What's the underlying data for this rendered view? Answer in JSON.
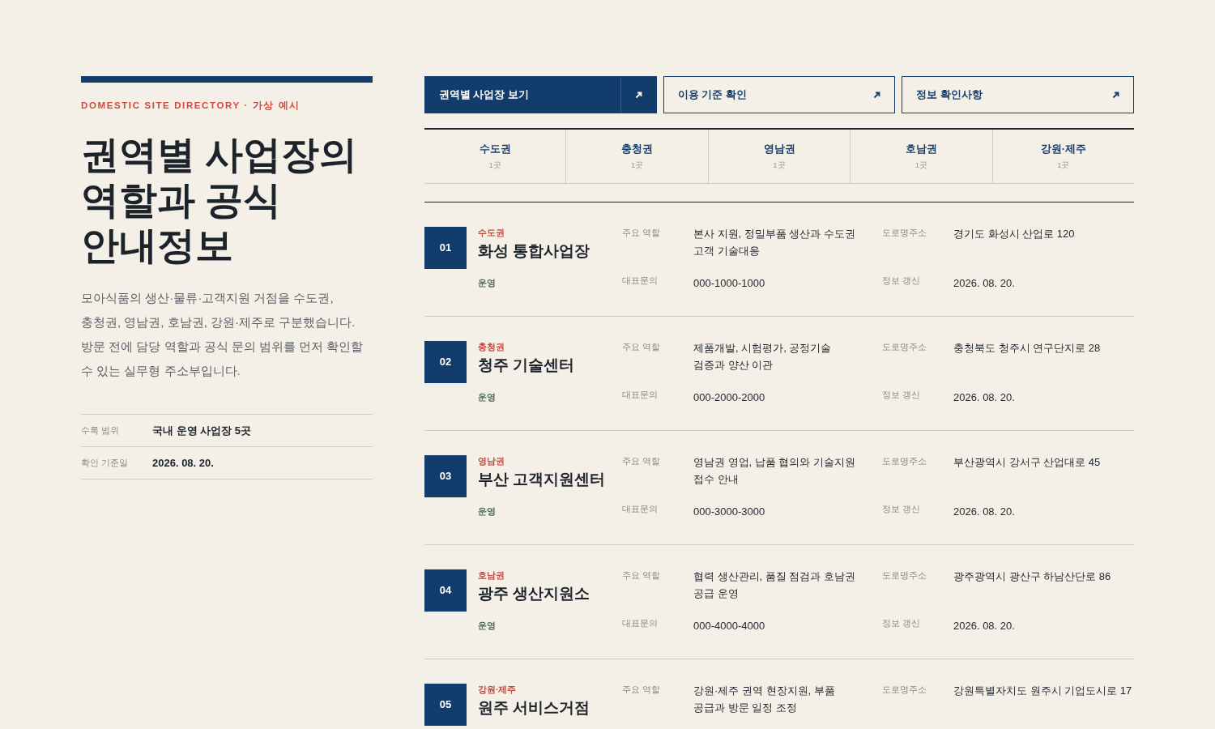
{
  "eyebrow": "DOMESTIC SITE DIRECTORY · 가상 예시",
  "title": [
    "권역별 사업장의",
    "역할과 공식",
    "안내정보"
  ],
  "intro": "모아식품의 생산·물류·고객지원 거점을 수도권, 충청권, 영남권, 호남권, 강원·제주로 구분했습니다. 방문 전에 담당 역할과 공식 문의 범위를 먼저 확인할 수 있는 실무형 주소부입니다.",
  "facts": [
    {
      "label": "수록 범위",
      "value": "국내 운영 사업장 5곳"
    },
    {
      "label": "확인 기준일",
      "value": "2026. 08. 20."
    }
  ],
  "buttons": [
    {
      "label": "권역별 사업장 보기",
      "selected": true
    },
    {
      "label": "이용 기준 확인",
      "selected": false
    },
    {
      "label": "정보 확인사항",
      "selected": false
    }
  ],
  "region_tabs": [
    {
      "name": "수도권",
      "count": "1곳"
    },
    {
      "name": "충청권",
      "count": "1곳"
    },
    {
      "name": "영남권",
      "count": "1곳"
    },
    {
      "name": "호남권",
      "count": "1곳"
    },
    {
      "name": "강원·제주",
      "count": "1곳"
    }
  ],
  "sites": [
    {
      "number": "01",
      "region": "수도권",
      "name": "화성 통합사업장",
      "status": "운영",
      "role_label": "주요 역할",
      "role": "본사 지원, 정밀부품 생산과 수도권 고객 기술대응",
      "address_label": "도로명주소",
      "address": "경기도 화성시 산업로 120",
      "phone_label": "대표문의",
      "phone": "000-1000-1000",
      "updated_label": "정보 갱신",
      "updated": "2026. 08. 20."
    },
    {
      "number": "02",
      "region": "충청권",
      "name": "청주 기술센터",
      "status": "운영",
      "role_label": "주요 역할",
      "role": "제품개발, 시험평가, 공정기술 검증과 양산 이관",
      "address_label": "도로명주소",
      "address": "충청북도 청주시 연구단지로 28",
      "phone_label": "대표문의",
      "phone": "000-2000-2000",
      "updated_label": "정보 갱신",
      "updated": "2026. 08. 20."
    },
    {
      "number": "03",
      "region": "영남권",
      "name": "부산 고객지원센터",
      "status": "운영",
      "role_label": "주요 역할",
      "role": "영남권 영업, 납품 협의와 기술지원 접수 안내",
      "address_label": "도로명주소",
      "address": "부산광역시 강서구 산업대로 45",
      "phone_label": "대표문의",
      "phone": "000-3000-3000",
      "updated_label": "정보 갱신",
      "updated": "2026. 08. 20."
    },
    {
      "number": "04",
      "region": "호남권",
      "name": "광주 생산지원소",
      "status": "운영",
      "role_label": "주요 역할",
      "role": "협력 생산관리, 품질 점검과 호남권 공급 운영",
      "address_label": "도로명주소",
      "address": "광주광역시 광산구 하남산단로 86",
      "phone_label": "대표문의",
      "phone": "000-4000-4000",
      "updated_label": "정보 갱신",
      "updated": "2026. 08. 20."
    },
    {
      "number": "05",
      "region": "강원·제주",
      "name": "원주 서비스거점",
      "role_label": "주요 역할",
      "role": "강원·제주 권역 현장지원, 부품 공급과 방문 일정 조정",
      "address_label": "도로명주소",
      "address": "강원특별자치도 원주시 기업도시로 17"
    }
  ]
}
